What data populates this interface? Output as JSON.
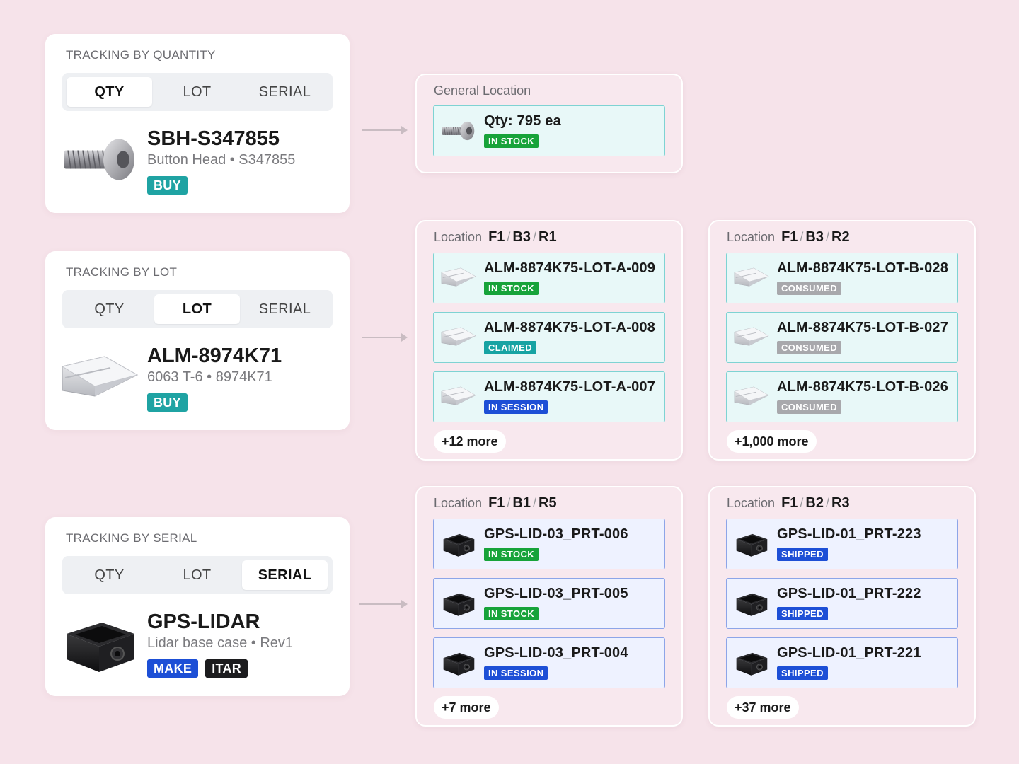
{
  "colors": {
    "background": "#f6e3ea",
    "in_stock": "#17a33a",
    "claimed": "#17a3a3",
    "in_session": "#1d4fd6",
    "consumed": "#a8a8ac",
    "shipped": "#1d4fd6",
    "buy_tag": "#1fa3a3",
    "make_tag": "#1d4fd6",
    "itar_tag": "#1c1c1e"
  },
  "segment_labels": [
    "QTY",
    "LOT",
    "SERIAL"
  ],
  "tracking": {
    "qty": {
      "title": "TRACKING BY QUANTITY",
      "active": "QTY",
      "part_name": "SBH-S347855",
      "part_sub": "Button Head • S347855",
      "tags": [
        "BUY"
      ],
      "icon": "screw-icon"
    },
    "lot": {
      "title": "TRACKING BY LOT",
      "active": "LOT",
      "part_name": "ALM-8974K71",
      "part_sub": "6063 T-6 • 8974K71",
      "tags": [
        "BUY"
      ],
      "icon": "aluminum-extrusion-icon"
    },
    "serial": {
      "title": "TRACKING BY SERIAL",
      "active": "SERIAL",
      "part_name": "GPS-LIDAR",
      "part_sub": "Lidar base case • Rev1",
      "tags": [
        "MAKE",
        "ITAR"
      ],
      "icon": "lidar-case-icon"
    }
  },
  "general": {
    "title": "General Location",
    "qty": "Qty: 795 ea",
    "status": "IN STOCK"
  },
  "loc_label": "Location",
  "loc_a": {
    "path": [
      "F1",
      "B3",
      "R1"
    ],
    "items": [
      {
        "name": "ALM-8874K75-LOT-A-009",
        "status": "IN STOCK"
      },
      {
        "name": "ALM-8874K75-LOT-A-008",
        "status": "CLAIMED"
      },
      {
        "name": "ALM-8874K75-LOT-A-007",
        "status": "IN SESSION"
      }
    ],
    "more": "+12 more"
  },
  "loc_b": {
    "path": [
      "F1",
      "B3",
      "R2"
    ],
    "items": [
      {
        "name": "ALM-8874K75-LOT-B-028",
        "status": "CONSUMED"
      },
      {
        "name": "ALM-8874K75-LOT-B-027",
        "status": "CONSUMED"
      },
      {
        "name": "ALM-8874K75-LOT-B-026",
        "status": "CONSUMED"
      }
    ],
    "more": "+1,000 more"
  },
  "loc_c": {
    "path": [
      "F1",
      "B1",
      "R5"
    ],
    "items": [
      {
        "name": "GPS-LID-03_PRT-006",
        "status": "IN STOCK"
      },
      {
        "name": "GPS-LID-03_PRT-005",
        "status": "IN STOCK"
      },
      {
        "name": "GPS-LID-03_PRT-004",
        "status": "IN SESSION"
      }
    ],
    "more": "+7 more"
  },
  "loc_d": {
    "path": [
      "F1",
      "B2",
      "R3"
    ],
    "items": [
      {
        "name": "GPS-LID-01_PRT-223",
        "status": "SHIPPED"
      },
      {
        "name": "GPS-LID-01_PRT-222",
        "status": "SHIPPED"
      },
      {
        "name": "GPS-LID-01_PRT-221",
        "status": "SHIPPED"
      }
    ],
    "more": "+37 more"
  }
}
